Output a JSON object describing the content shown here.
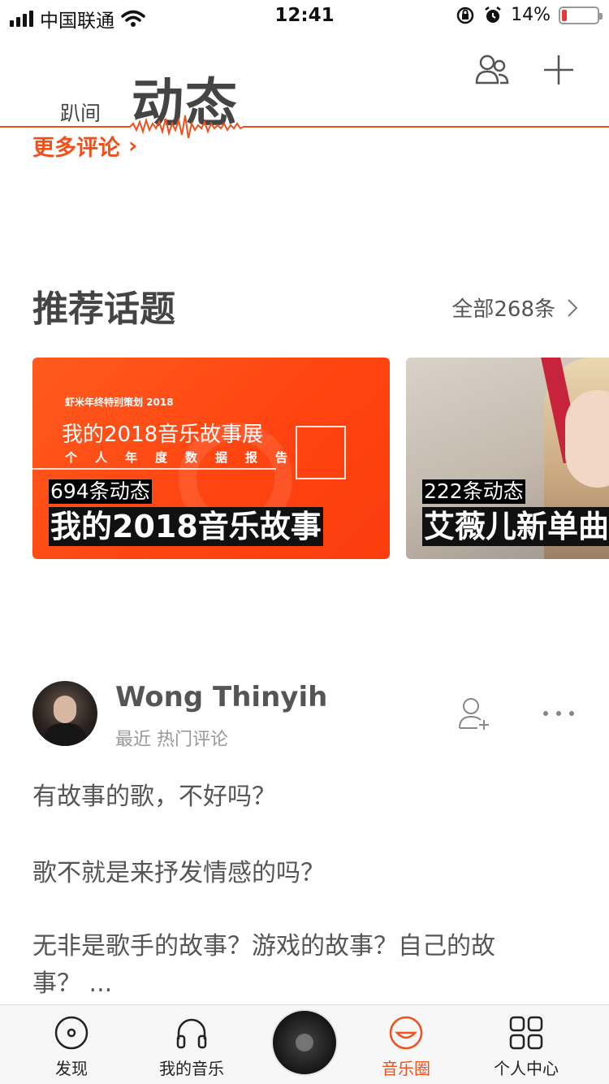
{
  "status_bar": {
    "carrier": "中国联通",
    "time": "12:41",
    "battery_percent": "14%",
    "battery_level": 0.14,
    "battery_color": "#e53935"
  },
  "header": {
    "tab_secondary": "趴间",
    "tab_primary": "动态",
    "icons": [
      "friends-icon",
      "add-icon"
    ]
  },
  "more_comments": {
    "label": "更多评论",
    "chevron": "›"
  },
  "topics": {
    "title": "推荐话题",
    "view_all": "全部268条",
    "cards": [
      {
        "count": "694条动态",
        "title": "我的2018音乐故事",
        "art_top": "虾米年终特别策划 2018",
        "art_title": "我的2018音乐故事展",
        "art_sub": "个人年度数据报告"
      },
      {
        "count": "222条动态",
        "title": "艾薇儿新单曲"
      }
    ]
  },
  "post": {
    "user": "Wong Thinyih",
    "meta": "最近 热门评论",
    "lines": [
      "有故事的歌，不好吗？",
      "歌不就是来抒发情感的吗？",
      "无非是歌手的故事？游戏的故事？自己的故",
      "事？ ..."
    ]
  },
  "tab_bar": {
    "items": [
      {
        "label": "发现",
        "icon": "disc-icon"
      },
      {
        "label": "我的音乐",
        "icon": "headphones-icon"
      },
      {
        "label": "音乐圈",
        "icon": "smile-icon",
        "active": true
      },
      {
        "label": "个人中心",
        "icon": "grid-icon"
      }
    ]
  },
  "colors": {
    "accent": "#f0501c",
    "text": "#444444",
    "muted": "#999999"
  }
}
